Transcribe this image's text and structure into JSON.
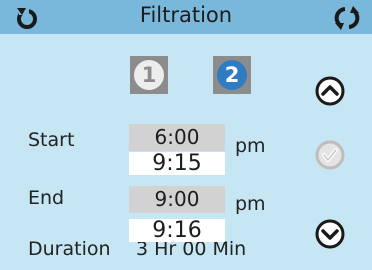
{
  "header": {
    "title": "Filtration"
  },
  "selector": {
    "one": "1",
    "two": "2"
  },
  "schedule": {
    "start_label": "Start",
    "start_time": "6:00",
    "start_unit": "pm",
    "end_label": "End",
    "end_time": "9:00",
    "end_unit": "pm",
    "duration_label": "Duration",
    "duration_value": "3 Hr 00 Min"
  },
  "overlays": {
    "upper": "9:15",
    "lower": "9:16"
  },
  "icons": {
    "back": "back-arrow-icon",
    "refresh": "refresh-icon",
    "up": "chevron-up-icon",
    "save": "checkmark-icon",
    "down": "chevron-down-icon"
  },
  "colors": {
    "header": "#79b8da",
    "background": "#c6e6f4",
    "selected": "#2f7cc2",
    "time_field": "#d2d2d2"
  }
}
